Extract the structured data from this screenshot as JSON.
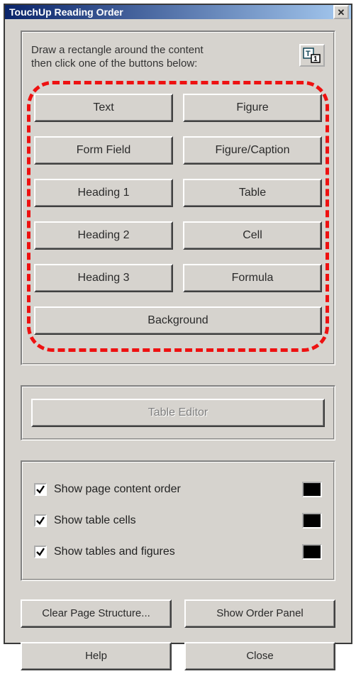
{
  "window": {
    "title": "TouchUp Reading Order"
  },
  "instruction": {
    "line1": "Draw a rectangle around the content",
    "line2": "then click one of the buttons below:"
  },
  "tag_buttons": {
    "text": "Text",
    "figure": "Figure",
    "form_field": "Form Field",
    "figure_caption": "Figure/Caption",
    "heading1": "Heading 1",
    "table": "Table",
    "heading2": "Heading 2",
    "cell": "Cell",
    "heading3": "Heading 3",
    "formula": "Formula",
    "background": "Background"
  },
  "table_editor": {
    "label": "Table Editor"
  },
  "checks": {
    "show_page_content_order": "Show page content order",
    "show_table_cells": "Show table cells",
    "show_tables_and_figures": "Show tables and figures"
  },
  "bottom": {
    "clear_page_structure": "Clear Page Structure...",
    "show_order_panel": "Show Order Panel",
    "help": "Help",
    "close": "Close"
  }
}
